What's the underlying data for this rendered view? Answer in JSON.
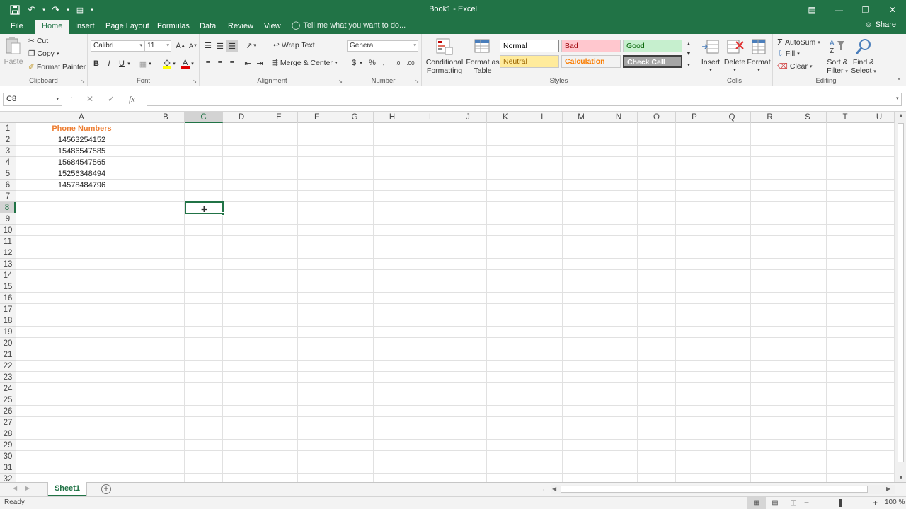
{
  "window": {
    "title": "Book1 - Excel"
  },
  "tabs": [
    "File",
    "Home",
    "Insert",
    "Page Layout",
    "Formulas",
    "Data",
    "Review",
    "View"
  ],
  "active_tab": "Home",
  "tell_me": "Tell me what you want to do...",
  "share": "Share",
  "ribbon": {
    "clipboard": {
      "label": "Clipboard",
      "paste": "Paste",
      "cut": "Cut",
      "copy": "Copy",
      "format_painter": "Format Painter"
    },
    "font": {
      "label": "Font",
      "font_name": "Calibri",
      "font_size": "11",
      "bold": "B",
      "italic": "I",
      "underline": "U"
    },
    "alignment": {
      "label": "Alignment",
      "wrap_text": "Wrap Text",
      "merge_center": "Merge & Center"
    },
    "number": {
      "label": "Number",
      "format": "General"
    },
    "styles": {
      "label": "Styles",
      "conditional_formatting": [
        "Conditional",
        "Formatting"
      ],
      "format_as_table": [
        "Format as",
        "Table"
      ],
      "cells": [
        {
          "label": "Normal",
          "bg": "#ffffff",
          "fg": "#000000"
        },
        {
          "label": "Bad",
          "bg": "#ffc7ce",
          "fg": "#9c0006"
        },
        {
          "label": "Good",
          "bg": "#c6efce",
          "fg": "#006100"
        },
        {
          "label": "Neutral",
          "bg": "#ffeb9c",
          "fg": "#9c6500"
        },
        {
          "label": "Calculation",
          "bg": "#f2f2f2",
          "fg": "#fa7d00"
        },
        {
          "label": "Check Cell",
          "bg": "#a5a5a5",
          "fg": "#ffffff"
        }
      ]
    },
    "cells": {
      "label": "Cells",
      "insert": "Insert",
      "delete": "Delete",
      "format": "Format"
    },
    "editing": {
      "label": "Editing",
      "autosum": "AutoSum",
      "fill": "Fill",
      "clear": "Clear",
      "sort_filter": [
        "Sort &",
        "Filter"
      ],
      "find_select": [
        "Find &",
        "Select"
      ]
    }
  },
  "formula_bar": {
    "name_box": "C8",
    "fx": "fx",
    "value": ""
  },
  "columns": [
    "A",
    "B",
    "C",
    "D",
    "E",
    "F",
    "G",
    "H",
    "I",
    "J",
    "K",
    "L",
    "M",
    "N",
    "O",
    "P",
    "Q",
    "R",
    "S",
    "T",
    "U"
  ],
  "selected_column": "C",
  "rows": [
    "1",
    "2",
    "3",
    "4",
    "5",
    "6",
    "7",
    "8",
    "9",
    "10",
    "11",
    "12",
    "13",
    "14",
    "15",
    "16",
    "17",
    "18",
    "19",
    "20",
    "21",
    "22",
    "23",
    "24",
    "25",
    "26",
    "27",
    "28",
    "29",
    "30",
    "31",
    "32"
  ],
  "selected_row": "8",
  "cell_data": {
    "header": "Phone Numbers",
    "values": [
      "14563254152",
      "15486547585",
      "15684547565",
      "15256348494",
      "14578484796"
    ]
  },
  "sheet_tab": "Sheet1",
  "status": {
    "ready": "Ready",
    "zoom": "100 %"
  },
  "accent_color": "#217346",
  "header_color": "#ed7d31"
}
